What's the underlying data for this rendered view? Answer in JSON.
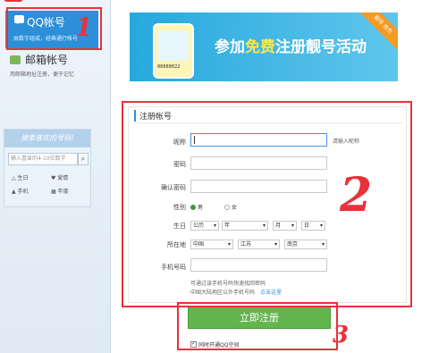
{
  "sidebar": {
    "qq_account": {
      "title": "QQ帐号",
      "desc": "由数字组成，经典通行帐号"
    },
    "email_account": {
      "title": "邮箱帐号",
      "desc": "用邮箱地址注册，便于记忆"
    },
    "search": {
      "heading": "搜索喜欢的号码!",
      "placeholder": "输入喜爱的4-10位数字",
      "tags": [
        "生日",
        "爱情",
        "手机",
        "年度"
      ]
    }
  },
  "banner": {
    "text_pre": "参加",
    "text_highlight": "免费",
    "text_post": "注册靓号活动",
    "phone_number": "88888822",
    "ribbon": "靓号 抢先"
  },
  "form": {
    "title": "注册帐号",
    "labels": {
      "nickname": "昵称",
      "password": "密码",
      "confirm": "确认密码",
      "gender": "性别",
      "birthday": "生日",
      "location": "所在地",
      "phone": "手机号码"
    },
    "nickname_hint": "请输入昵称",
    "gender_options": {
      "male": "男",
      "female": "女"
    },
    "birthday": {
      "calendar": "公历",
      "year": "年",
      "month": "月",
      "day": "日"
    },
    "location": {
      "country": "中国",
      "province": "江苏",
      "city": "南京"
    },
    "phone_note_1": "可通过该手机号码快速找回密码",
    "phone_note_2": "中国大陆地区以外手机号码",
    "phone_note_link": "点击这里"
  },
  "submit_label": "立即注册",
  "agree_label": "同时开通QQ空间",
  "annotations": {
    "one": "1",
    "two": "2",
    "three": "3"
  },
  "colors": {
    "accent": "#2d8fd7",
    "submit": "#63b54e",
    "annotation": "#e8313a"
  }
}
